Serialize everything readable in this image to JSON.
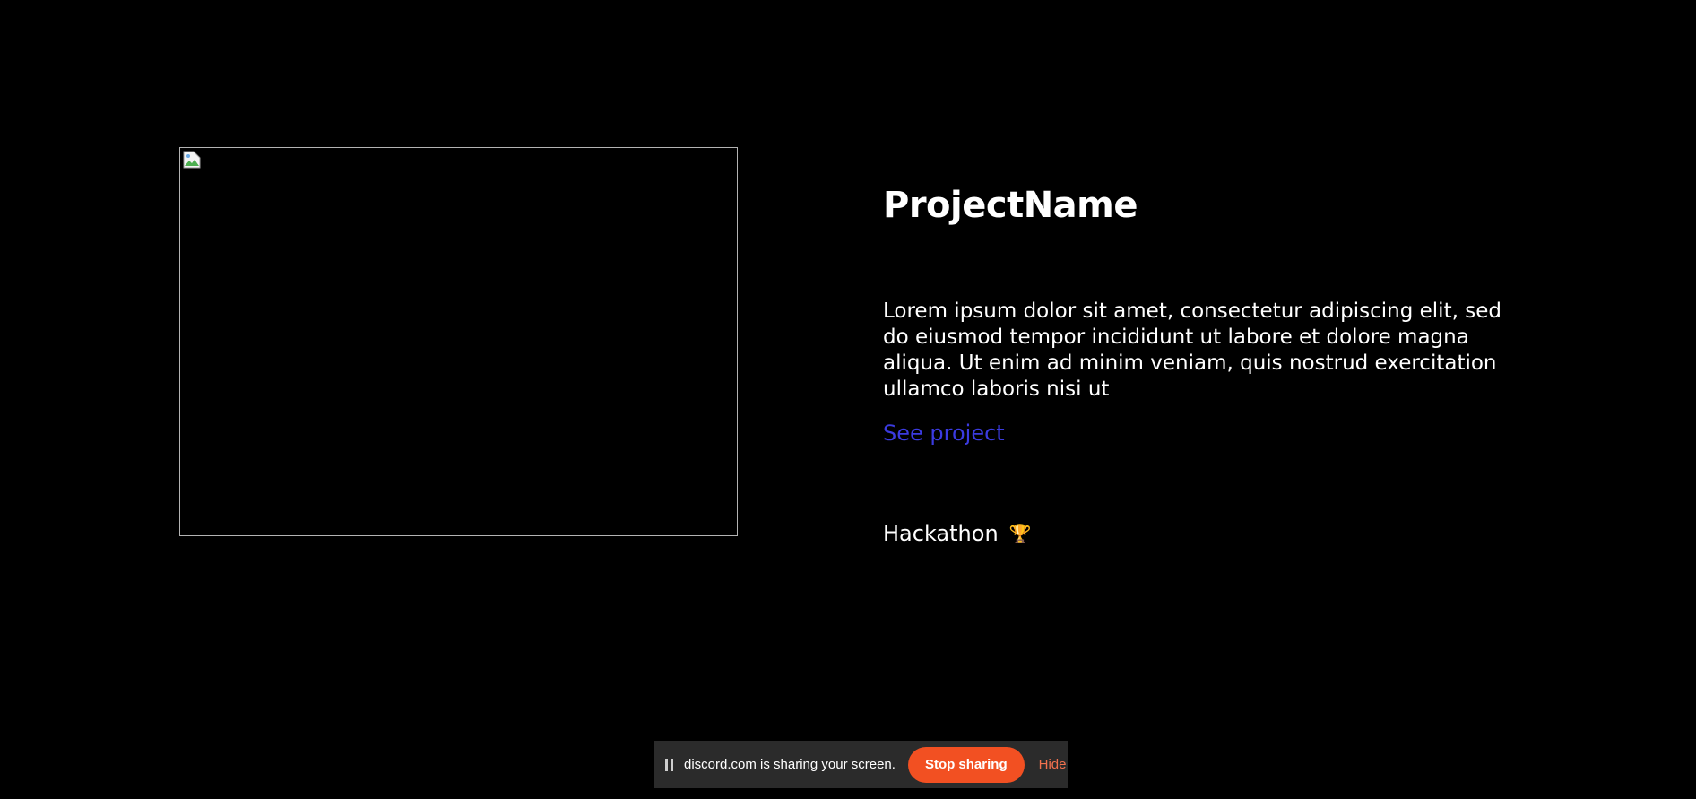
{
  "project": {
    "title": "ProjectName",
    "description": "Lorem ipsum dolor sit amet, consectetur adipiscing elit, sed do eiusmod tempor incididunt ut labore et dolore magna aliqua. Ut enim ad minim veniam, quis nostrud exercitation ullamco laboris nisi ut",
    "link_label": "See project",
    "award_label": "Hackathon",
    "award_icon": "trophy-icon",
    "image_icon": "broken-image-icon"
  },
  "share_bar": {
    "message": "discord.com is sharing your screen.",
    "stop_label": "Stop sharing",
    "hide_label": "Hide",
    "icon": "pause-icon",
    "stop_color": "#f25022"
  },
  "colors": {
    "background": "#000000",
    "text": "#ffffff",
    "link": "#3b3be0"
  }
}
